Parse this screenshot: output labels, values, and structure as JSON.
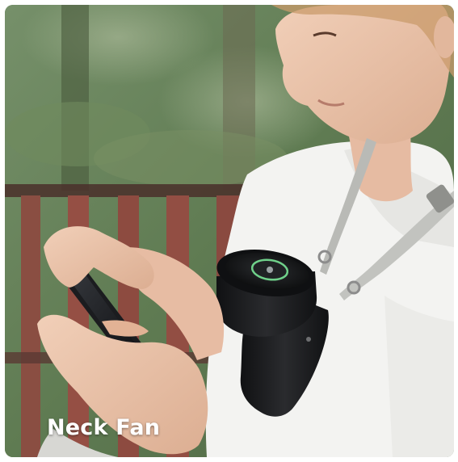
{
  "product_photo": {
    "caption": "Neck Fan",
    "subject": "woman-looking-at-phone",
    "device": "neck-fan-icon",
    "colors": {
      "foliage": "#5d7a4e",
      "bench": "#8a4e42",
      "shirt": "#f3f3f1",
      "skin": "#ecc7ae",
      "fan": "#1c1d1f",
      "strap": "#b9bab6",
      "fan_ring": "#6fd08a"
    }
  }
}
